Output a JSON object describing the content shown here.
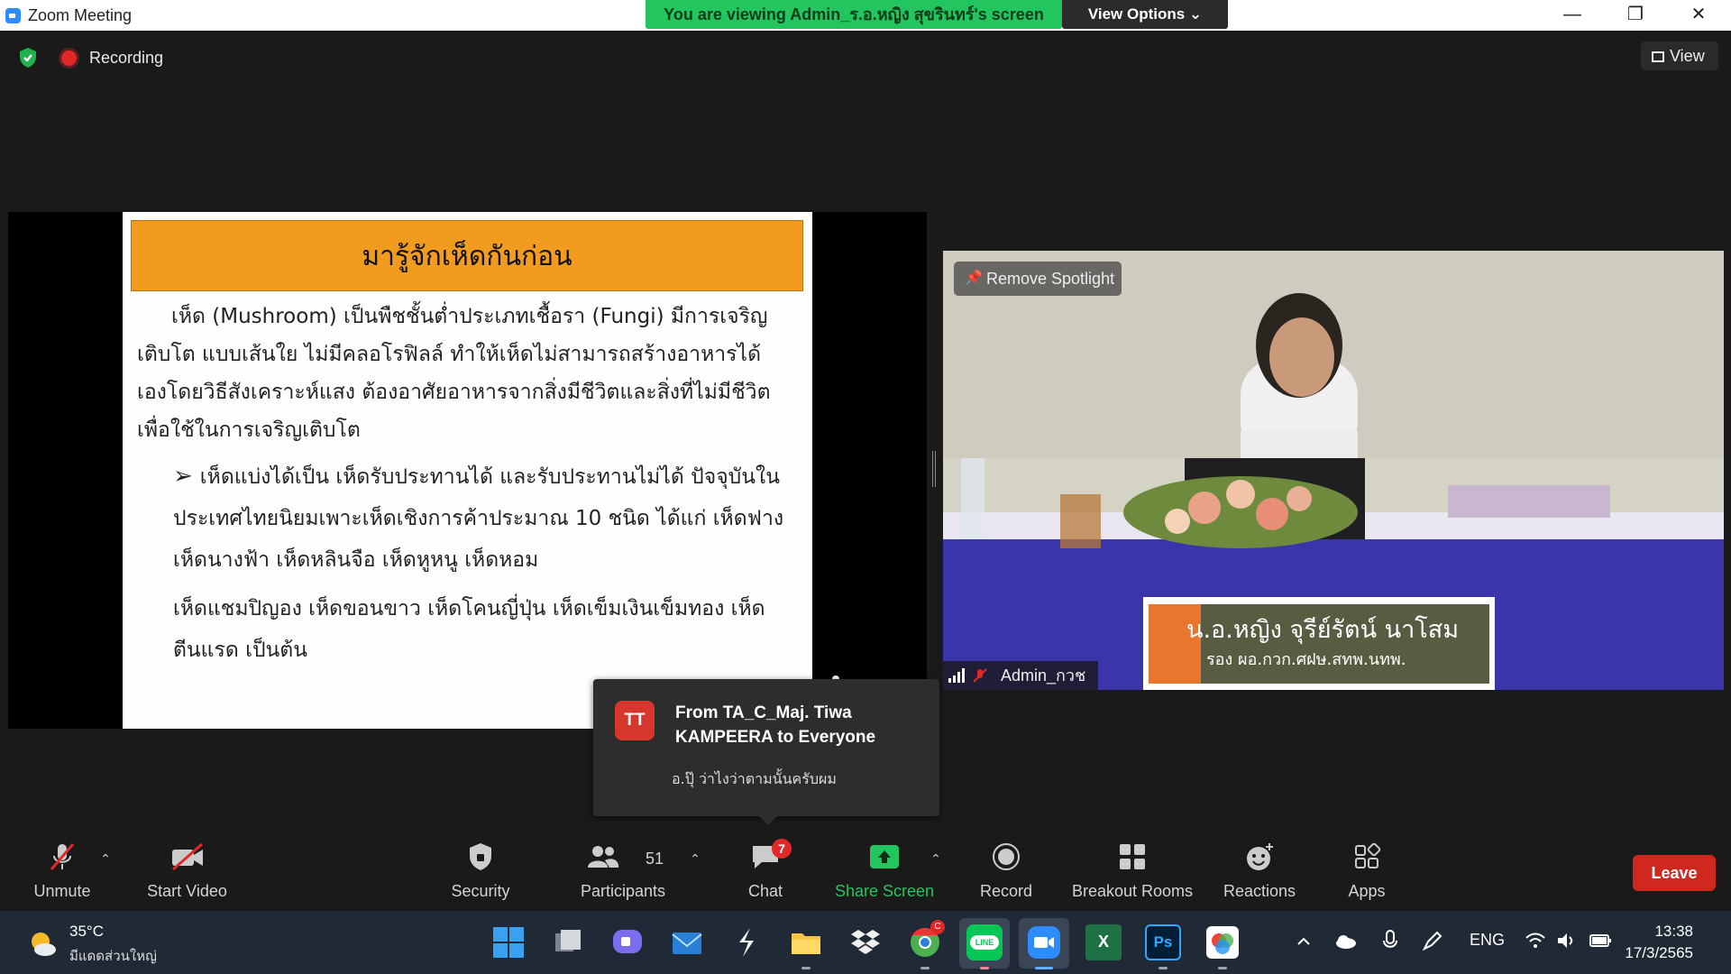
{
  "window": {
    "title": "Zoom Meeting",
    "banner": "You are viewing Admin_ร.อ.หญิง สุขรินทร์'s screen",
    "view_options": "View Options ⌄",
    "minimize": "—",
    "restore": "❐",
    "close": "✕"
  },
  "meeting": {
    "recording_label": "Recording",
    "view_label": "View"
  },
  "slide": {
    "heading": "มารู้จักเห็ดกันก่อน",
    "paragraph": "เห็ด (Mushroom) เป็นพืชชั้นต่ำประเภทเชื้อรา (Fungi) มีการเจริญเติบโต แบบเส้นใย ไม่มีคลอโรฟิลล์ ทำให้เห็ดไม่สามารถสร้างอาหารได้เองโดยวิธีสังเคราะห์แสง ต้องอาศัยอาหารจากสิ่งมีชีวิตและสิ่งที่ไม่มีชีวิต เพื่อใช้ในการเจริญเติบโต",
    "bullet_mark": "➢",
    "bullet": "เห็ดแบ่งได้เป็น เห็ดรับประทานได้ และรับประทานไม่ได้ ปัจจุบันในประเทศไทยนิยมเพาะเห็ดเชิงการค้าประมาณ 10 ชนิด ได้แก่ เห็ดฟาง เห็ดนางฟ้า เห็ดหลินจือ เห็ดหูหนู เห็ดหอม",
    "continuation": "เห็ดแชมปิญอง เห็ดขอนขาว เห็ดโคนญี่ปุ่น เห็ดเข็มเงินเข็มทอง เห็ดตีนแรด เป็นต้น"
  },
  "video": {
    "spotlight_button": "Remove Spotlight",
    "participant_name": "Admin_กวช",
    "nameplate_line1": "น.อ.หญิง จุรีย์รัตน์ นาโสม",
    "nameplate_line2": "รอง ผอ.กวก.ศฝษ.สทพ.นทพ."
  },
  "chat_popup": {
    "avatar_initials": "TT",
    "from": "From TA_C_Maj. Tiwa KAMPEERA to Everyone",
    "message": "อ.ปุ๊ ว่าไงว่าตามนั้นครับผม"
  },
  "toolbar": {
    "unmute": "Unmute",
    "start_video": "Start Video",
    "security": "Security",
    "participants": "Participants",
    "participants_count": "51",
    "chat": "Chat",
    "chat_badge": "7",
    "share_screen": "Share Screen",
    "record": "Record",
    "breakout_rooms": "Breakout Rooms",
    "reactions": "Reactions",
    "apps": "Apps",
    "leave": "Leave",
    "caret": "⌃"
  },
  "taskbar": {
    "temperature": "35°C",
    "weather_desc": "มีแดดส่วนใหญ่",
    "language": "ENG",
    "time": "13:38",
    "date": "17/3/2565",
    "chrome_badge": "C",
    "line_label": "LINE",
    "excel_label": "X",
    "ps_label": "Ps"
  },
  "colors": {
    "share_green": "#22c55e",
    "leave_red": "#d0281f",
    "slide_header": "#f29c1f",
    "badge_red": "#e02828"
  }
}
